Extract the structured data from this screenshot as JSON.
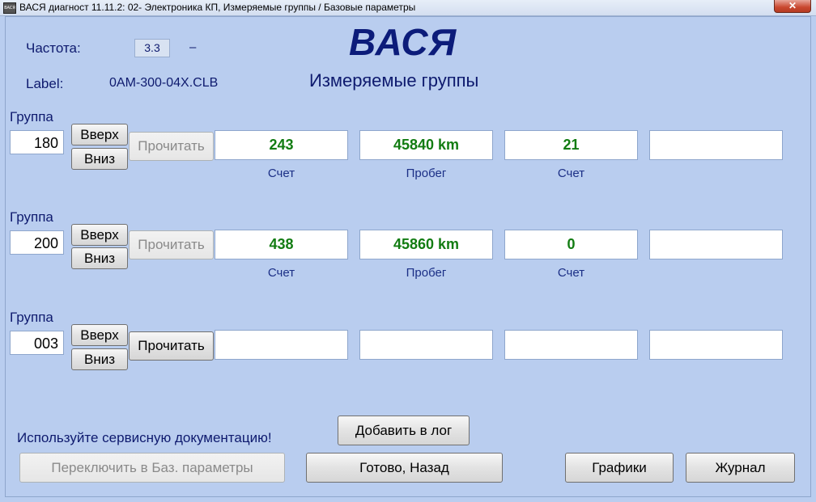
{
  "window": {
    "title": "ВАСЯ диагност 11.11.2: 02- Электроника КП,  Измеряемые группы / Базовые параметры",
    "icon_label": "ВАСЯ",
    "close_symbol": "✕"
  },
  "header": {
    "freq_label": "Частота:",
    "freq_value": "3.3",
    "freq_dash": "–",
    "label_label": "Label:",
    "label_value": "0AM-300-04X.CLB",
    "brand": "ВАСЯ",
    "subtitle": "Измеряемые группы"
  },
  "groups": [
    {
      "label": "Группа",
      "number": "180",
      "up_label": "Вверх",
      "down_label": "Вниз",
      "read_label": "Прочитать",
      "read_enabled": false,
      "fields": [
        {
          "value": "243",
          "unit": "Счет"
        },
        {
          "value": "45840 km",
          "unit": "Пробег"
        },
        {
          "value": "21",
          "unit": "Счет"
        },
        {
          "value": "",
          "unit": ""
        }
      ]
    },
    {
      "label": "Группа",
      "number": "200",
      "up_label": "Вверх",
      "down_label": "Вниз",
      "read_label": "Прочитать",
      "read_enabled": false,
      "fields": [
        {
          "value": "438",
          "unit": "Счет"
        },
        {
          "value": "45860 km",
          "unit": "Пробег"
        },
        {
          "value": "0",
          "unit": "Счет"
        },
        {
          "value": "",
          "unit": ""
        }
      ]
    },
    {
      "label": "Группа",
      "number": "003",
      "up_label": "Вверх",
      "down_label": "Вниз",
      "read_label": "Прочитать",
      "read_enabled": true,
      "fields": [
        {
          "value": "",
          "unit": ""
        },
        {
          "value": "",
          "unit": ""
        },
        {
          "value": "",
          "unit": ""
        },
        {
          "value": "",
          "unit": ""
        }
      ]
    }
  ],
  "footer": {
    "hint": "Используйте сервисную документацию!",
    "add_log": "Добавить в лог",
    "switch_basic": "Переключить в Баз. параметры",
    "done_back": "Готово, Назад",
    "graphs": "Графики",
    "journal": "Журнал"
  },
  "colors": {
    "background": "#b9cdef",
    "value_text": "#127c12",
    "label_text": "#0e1a6e",
    "brand_text": "#0c1c7a"
  }
}
